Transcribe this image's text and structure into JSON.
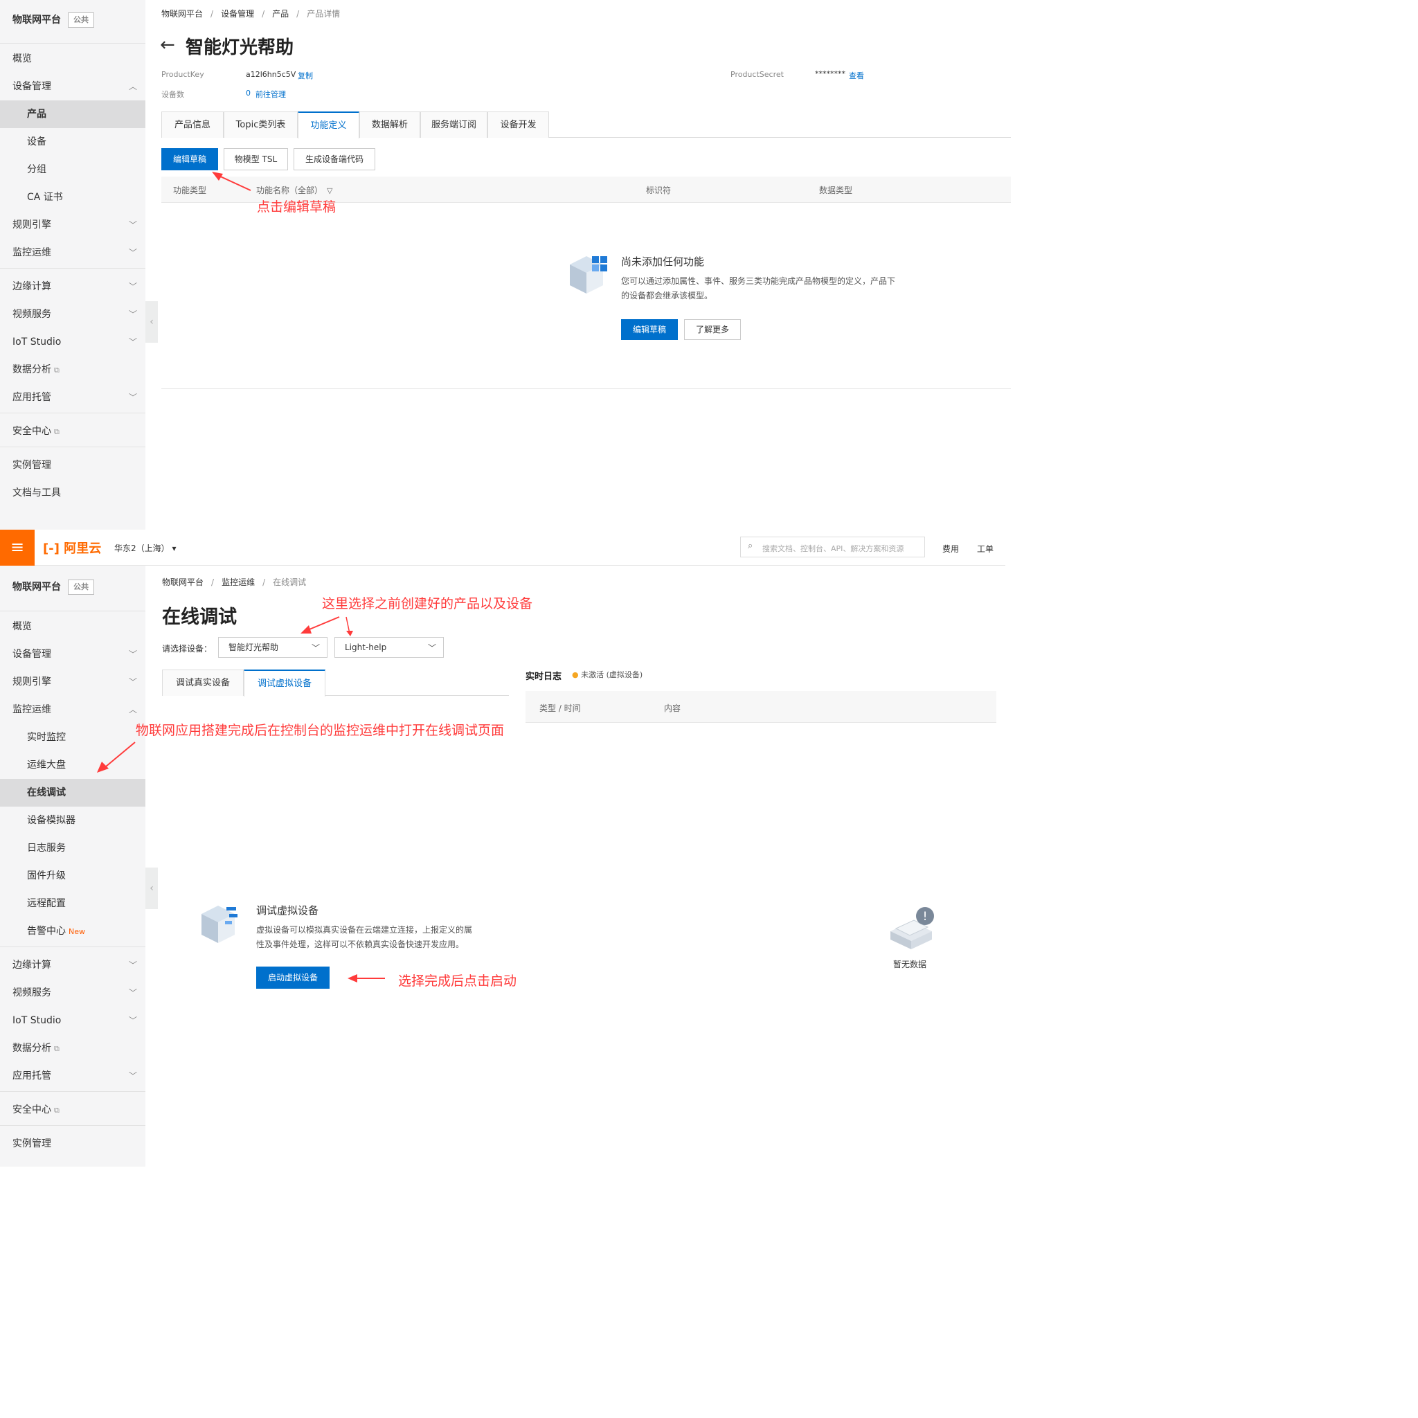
{
  "top": {
    "sidebar": {
      "platform": "物联网平台",
      "badge": "公共",
      "items": [
        "概览",
        "设备管理",
        "产品",
        "设备",
        "分组",
        "CA 证书",
        "规则引擎",
        "监控运维",
        "边缘计算",
        "视频服务",
        "IoT Studio",
        "数据分析",
        "应用托管",
        "安全中心",
        "实例管理",
        "文档与工具"
      ]
    },
    "breadcrumb": [
      "物联网平台",
      "设备管理",
      "产品",
      "产品详情"
    ],
    "title": "智能灯光帮助",
    "info": {
      "product_key_label": "ProductKey",
      "product_key_value": "a12l6hn5c5V",
      "copy": "复制",
      "product_secret_label": "ProductSecret",
      "product_secret_value": "********",
      "view": "查看",
      "device_count_label": "设备数",
      "device_count_value": "0",
      "manage": "前往管理"
    },
    "tabs": [
      "产品信息",
      "Topic类列表",
      "功能定义",
      "数据解析",
      "服务端订阅",
      "设备开发"
    ],
    "actions": [
      "编辑草稿",
      "物模型 TSL",
      "生成设备端代码"
    ],
    "table_headers": [
      "功能类型",
      "功能名称（全部）",
      "标识符",
      "数据类型"
    ],
    "empty": {
      "title": "尚未添加任何功能",
      "desc1": "您可以通过添加属性、事件、服务三类功能完成产品物模型的定义，产品下",
      "desc2": "的设备都会继承该模型。",
      "btn_edit": "编辑草稿",
      "btn_more": "了解更多"
    },
    "annotation": "点击编辑草稿"
  },
  "bottom": {
    "topbar": {
      "brand": "阿里云",
      "region": "华东2（上海）",
      "search_placeholder": "搜索文档、控制台、API、解决方案和资源",
      "links": [
        "费用",
        "工单"
      ]
    },
    "sidebar": {
      "platform": "物联网平台",
      "badge": "公共",
      "items": [
        "概览",
        "设备管理",
        "规则引擎",
        "监控运维",
        "实时监控",
        "运维大盘",
        "在线调试",
        "设备模拟器",
        "日志服务",
        "固件升级",
        "远程配置",
        "告警中心",
        "边缘计算",
        "视频服务",
        "IoT Studio",
        "数据分析",
        "应用托管",
        "安全中心",
        "实例管理"
      ],
      "new_tag": "New"
    },
    "breadcrumb": [
      "物联网平台",
      "监控运维",
      "在线调试"
    ],
    "title": "在线调试",
    "select_label": "请选择设备：",
    "product_select": "智能灯光帮助",
    "device_select": "Light-help",
    "tabs": [
      "调试真实设备",
      "调试虚拟设备"
    ],
    "log": {
      "title": "实时日志",
      "status": "未激活 (虚拟设备)",
      "headers": [
        "类型 / 时间",
        "内容"
      ],
      "empty": "暂无数据"
    },
    "virtual": {
      "title": "调试虚拟设备",
      "desc1": "虚拟设备可以模拟真实设备在云端建立连接，上报定义的属",
      "desc2": "性及事件处理，这样可以不依赖真实设备快速开发应用。",
      "btn": "启动虚拟设备"
    },
    "annotations": [
      "这里选择之前创建好的产品以及设备",
      "物联网应用搭建完成后在控制台的监控运维中打开在线调试页面",
      "选择完成后点击启动"
    ]
  },
  "colors": {
    "primary": "#0070cc",
    "annotation": "#ff3b3b",
    "brand": "#ff6a00"
  },
  "icons": [
    "back-arrow-icon",
    "filter-icon",
    "chevron-down-icon",
    "external-link-icon",
    "hamburger-icon",
    "search-icon",
    "cube-icon",
    "empty-box-icon"
  ]
}
